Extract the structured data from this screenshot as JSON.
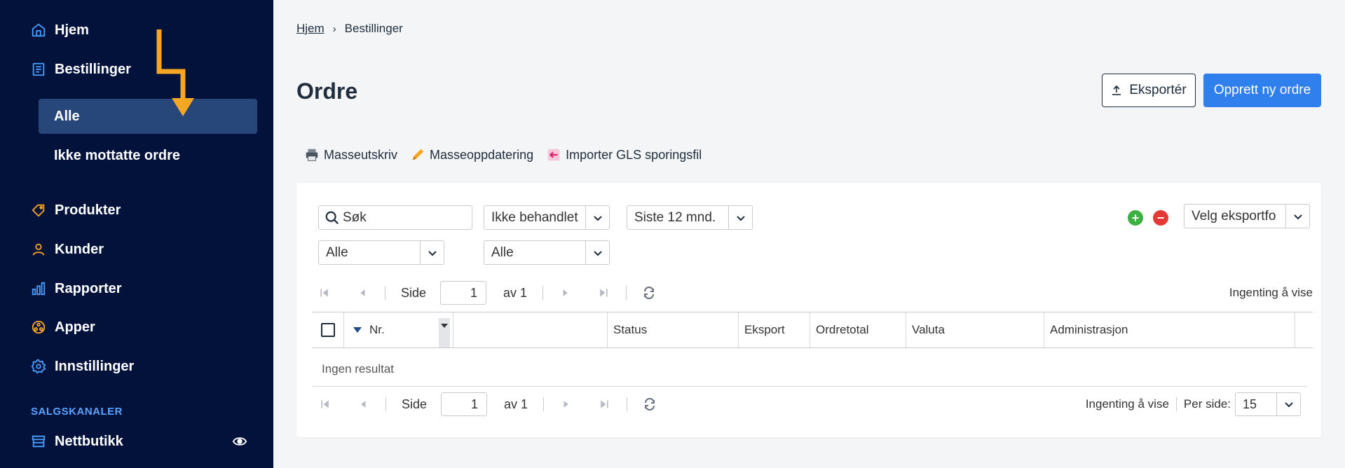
{
  "sidebar": {
    "items": [
      {
        "label": "Hjem",
        "icon": "home-icon"
      },
      {
        "label": "Bestillinger",
        "icon": "orders-icon"
      },
      {
        "label": "Produkter",
        "icon": "tag-icon"
      },
      {
        "label": "Kunder",
        "icon": "user-icon"
      },
      {
        "label": "Rapporter",
        "icon": "chart-icon"
      },
      {
        "label": "Apper",
        "icon": "apps-icon"
      },
      {
        "label": "Innstillinger",
        "icon": "gear-icon"
      }
    ],
    "subitems": [
      {
        "label": "Alle",
        "active": true
      },
      {
        "label": "Ikke mottatte ordre",
        "active": false
      }
    ],
    "section_label": "SALGSKANALER",
    "channel": {
      "label": "Nettbutikk",
      "icon": "store-icon"
    },
    "accent_color": "#4a9eff",
    "bg_color": "#03123a"
  },
  "breadcrumb": {
    "home": "Hjem",
    "current": "Bestillinger"
  },
  "page_title": "Ordre",
  "actions": {
    "export_label": "Eksportér",
    "new_order_label": "Opprett ny ordre"
  },
  "toolbar": {
    "print_label": "Masseutskriv",
    "update_label": "Masseoppdatering",
    "import_label": "Importer GLS sporingsfil"
  },
  "filters": {
    "search_value": "Søk",
    "status_value": "Ikke behandlet",
    "period_value": "Siste 12 mnd.",
    "export_format_value": "Velg eksportfo",
    "filter3_value": "Alle",
    "filter4_value": "Alle"
  },
  "pager": {
    "page_label": "Side",
    "page_value": "1",
    "of_label": "av 1",
    "empty_label": "Ingenting å vise",
    "per_page_label": "Per side:",
    "per_page_value": "15"
  },
  "grid": {
    "columns": [
      "Nr.",
      "",
      "Status",
      "Eksport",
      "Ordretotal",
      "Valuta",
      "Administrasjon"
    ],
    "empty_text": "Ingen resultat"
  }
}
